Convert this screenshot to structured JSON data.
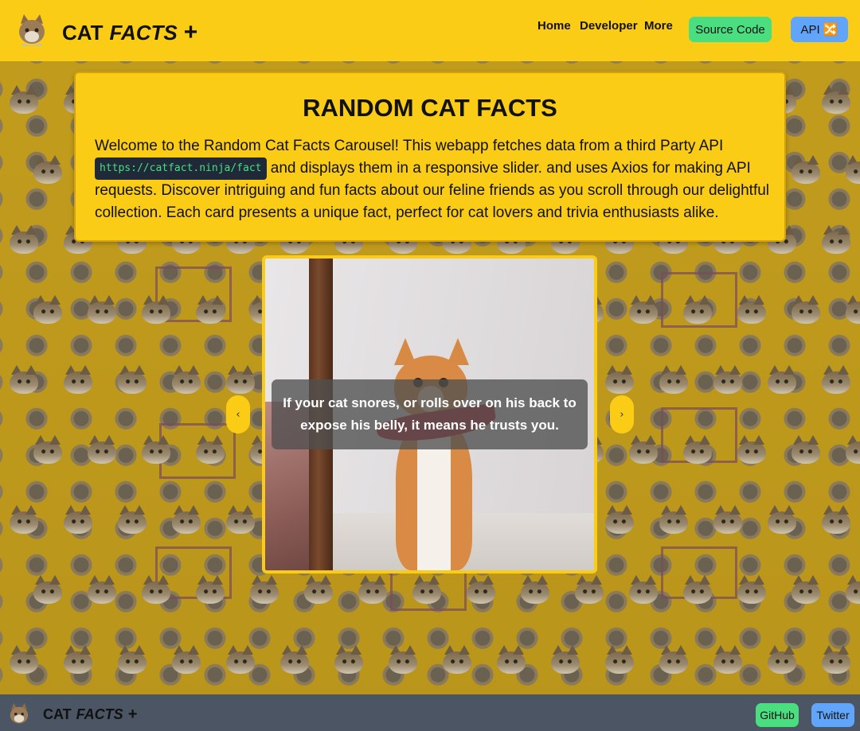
{
  "header": {
    "brand": {
      "cat": "CAT",
      "facts": "FACTS",
      "plus": "+"
    },
    "nav": [
      {
        "label": "Home"
      },
      {
        "label": "Developer"
      },
      {
        "label": "More"
      }
    ],
    "source_button": "Source Code",
    "api_button": "API 🔀"
  },
  "intro": {
    "title": "RANDOM CAT FACTS",
    "text_before": "Welcome to the Random Cat Facts Carousel! This webapp fetches data from a third Party API ",
    "api_url": "https://catfact.ninja/fact",
    "text_after": " and displays them in a responsive slider. and uses Axios for making API requests. Discover intriguing and fun facts about our feline friends as you scroll through our delightful collection. Each card presents a unique fact, perfect for cat lovers and trivia enthusiasts alike."
  },
  "carousel": {
    "fact": "If your cat snores, or rolls over on his back to expose his belly, it means he trusts you.",
    "prev_label": "‹",
    "next_label": "›"
  },
  "footer": {
    "brand": {
      "cat": "CAT",
      "facts": "FACTS",
      "plus": "+"
    },
    "github_button": "GitHub",
    "twitter_button": "Twitter"
  },
  "colors": {
    "accent_yellow": "#facc15",
    "button_green": "#4ade80",
    "button_blue": "#60a5fa",
    "footer_gray": "#4b5563"
  }
}
